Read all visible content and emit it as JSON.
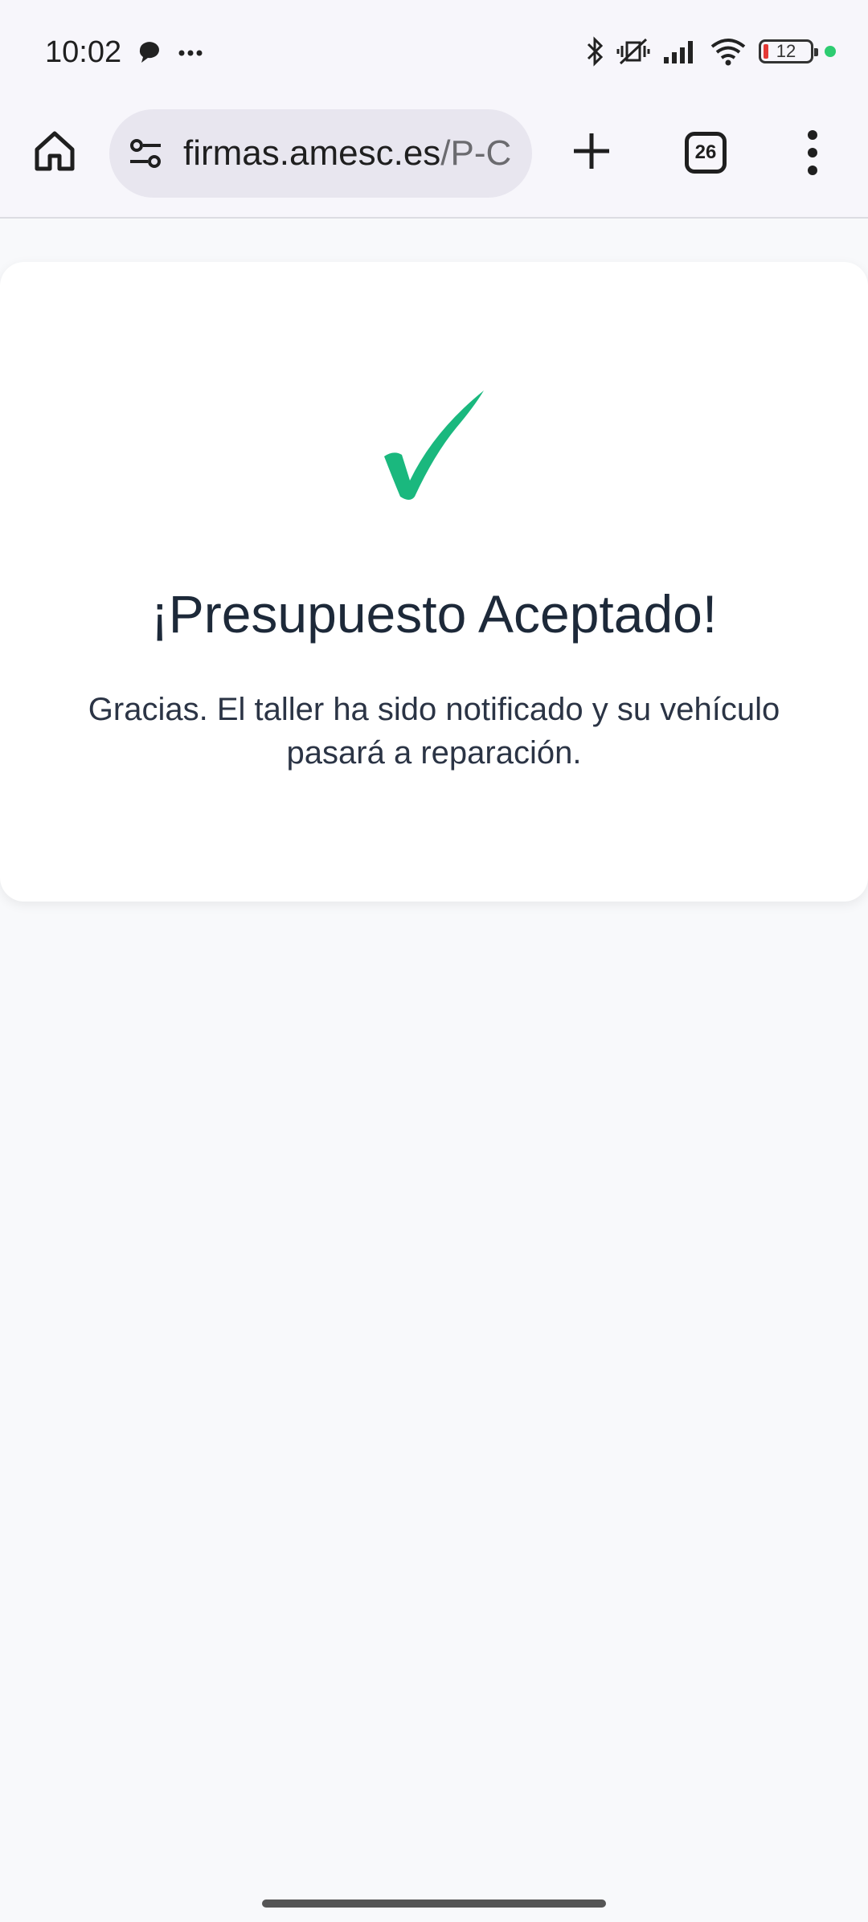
{
  "status_bar": {
    "time": "10:02",
    "battery_level": "12",
    "colors": {
      "battery_low": "#e53935",
      "dot": "#2ecc71"
    },
    "icons": [
      "chat-bubble-icon",
      "more-dots-icon",
      "bluetooth-icon",
      "vibrate-off-icon",
      "signal-icon",
      "wifi-icon",
      "battery-icon"
    ]
  },
  "browser": {
    "url_domain": "firmas.amesc.es",
    "url_path": "/P-C",
    "tab_count": "26"
  },
  "card": {
    "title": "¡Presupuesto Aceptado!",
    "message": "Gracias. El taller ha sido notificado y su vehículo pasará a reparación.",
    "check_color": "#1ab87e"
  }
}
